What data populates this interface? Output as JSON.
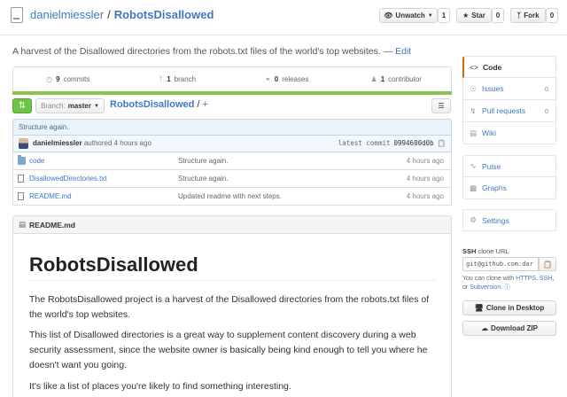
{
  "header": {
    "owner": "danielmiessler",
    "separator": "/",
    "repo": "RobotsDisallowed",
    "watch_label": "Unwatch",
    "watch_count": "1",
    "star_label": "Star",
    "star_count": "0",
    "fork_label": "Fork",
    "fork_count": "0"
  },
  "description": {
    "text": "A harvest of the Disallowed directories from the robots.txt files of the world's top websites. —",
    "edit": "Edit"
  },
  "summary": {
    "commits_count": "9",
    "commits_label": "commits",
    "branches_count": "1",
    "branches_label": "branch",
    "releases_count": "0",
    "releases_label": "releases",
    "contributors_count": "1",
    "contributors_label": "contributor"
  },
  "lang_bar_color": "#89c44c",
  "file_nav": {
    "branch_prefix": "Branch:",
    "branch_name": "master",
    "breadcrumb_repo": "RobotsDisallowed",
    "breadcrumb_sep": "/",
    "breadcrumb_plus": "+"
  },
  "commit": {
    "message": "Structure again.",
    "author": "danielmiessler",
    "authored_text": "authored 4 hours ago",
    "latest_label": "latest commit",
    "sha": "0994600d0b"
  },
  "files": [
    {
      "type": "dir",
      "name": "code",
      "message": "Structure again.",
      "age": "4 hours ago"
    },
    {
      "type": "file",
      "name": "DisallowedDirectories.txt",
      "message": "Structure again.",
      "age": "4 hours ago"
    },
    {
      "type": "file",
      "name": "README.md",
      "message": "Updated readme with next steps.",
      "age": "4 hours ago"
    }
  ],
  "readme": {
    "header": "README.md",
    "title": "RobotsDisallowed",
    "p1": "The RobotsDisallowed project is a harvest of the Disallowed directories from the robots.txt files of the world's top websites.",
    "p2": "This list of Disallowed directories is a great way to supplement content discovery during a web security assessment, since the website owner is basically being kind enough to tell you where he doesn't want you going.",
    "p3": "It's like a list of places you're likely to find something interesting."
  },
  "sidebar": {
    "code": "Code",
    "issues": "Issues",
    "issues_count": "0",
    "pulls": "Pull requests",
    "pulls_count": "0",
    "wiki": "Wiki",
    "pulse": "Pulse",
    "graphs": "Graphs",
    "settings": "Settings",
    "clone_proto": "SSH",
    "clone_label": "clone URL",
    "clone_url": "git@github.com:dar",
    "clone_help_pre": "You can clone with",
    "clone_https": "HTTPS",
    "clone_ssh": "SSH",
    "clone_or": "or",
    "clone_subversion": "Subversion",
    "clone_desktop": "Clone in Desktop",
    "download_zip": "Download ZIP"
  }
}
